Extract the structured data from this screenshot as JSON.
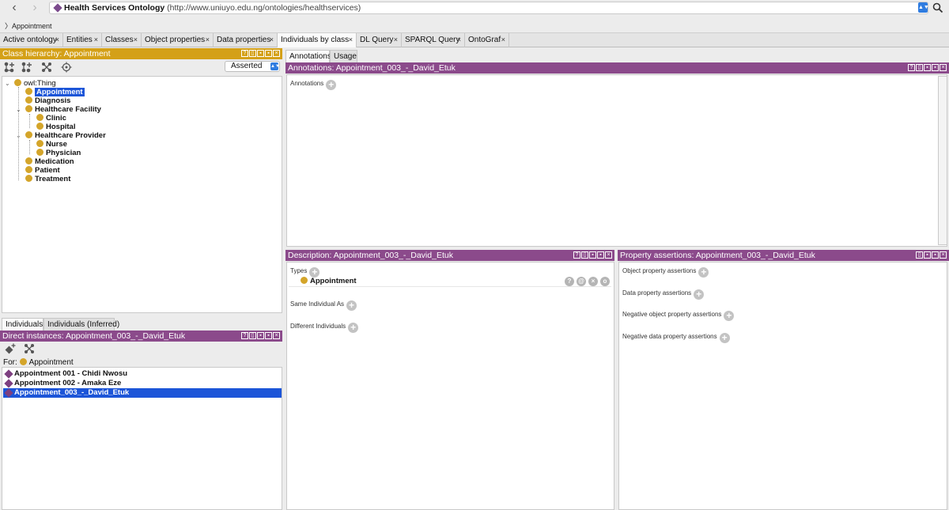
{
  "window": {
    "title": "Health Services Ontology",
    "iri": "(http://www.uniuyo.edu.ng/ontologies/healthservices)",
    "breadcrumb": "Appointment"
  },
  "tabs": [
    {
      "label": "Active ontology"
    },
    {
      "label": "Entities"
    },
    {
      "label": "Classes"
    },
    {
      "label": "Object properties"
    },
    {
      "label": "Data properties"
    },
    {
      "label": "Individuals by class"
    },
    {
      "label": "DL Query"
    },
    {
      "label": "SPARQL Query"
    },
    {
      "label": "OntoGraf"
    }
  ],
  "class_hierarchy": {
    "title": "Class hierarchy: Appointment",
    "mode": "Asserted",
    "items": [
      {
        "label": "owl:Thing"
      },
      {
        "label": "Appointment"
      },
      {
        "label": "Diagnosis"
      },
      {
        "label": "Healthcare Facility"
      },
      {
        "label": "Clinic"
      },
      {
        "label": "Hospital"
      },
      {
        "label": "Healthcare Provider"
      },
      {
        "label": "Nurse"
      },
      {
        "label": "Physician"
      },
      {
        "label": "Medication"
      },
      {
        "label": "Patient"
      },
      {
        "label": "Treatment"
      }
    ]
  },
  "individuals_tabs": [
    "Individuals",
    "Individuals (Inferred)"
  ],
  "direct_instances": {
    "title": "Direct instances: Appointment_003_-_David_Etuk",
    "for_label": "For:",
    "for_value": "Appointment",
    "items": [
      {
        "label": "Appointment 001 - Chidi Nwosu"
      },
      {
        "label": "Appointment 002 - Amaka Eze"
      },
      {
        "label": "Appointment_003_-_David_Etuk"
      }
    ]
  },
  "right_tabs": [
    "Annotations",
    "Usage"
  ],
  "annotations": {
    "title": "Annotations: Appointment_003_-_David_Etuk",
    "label": "Annotations"
  },
  "description": {
    "title": "Description: Appointment_003_-_David_Etuk",
    "types_label": "Types",
    "type_value": "Appointment",
    "same_label": "Same Individual As",
    "different_label": "Different Individuals"
  },
  "property_assertions": {
    "title": "Property assertions: Appointment_003_-_David_Etuk",
    "object_label": "Object property assertions",
    "data_label": "Data property assertions",
    "neg_object_label": "Negative object property assertions",
    "neg_data_label": "Negative data property assertions"
  },
  "colors": {
    "class_header": "#d4a017",
    "individual_header": "#8b4a8b",
    "selection": "#1c55d8",
    "class_dot": "#d4a52a",
    "individual_diamond": "#7d3f80"
  }
}
